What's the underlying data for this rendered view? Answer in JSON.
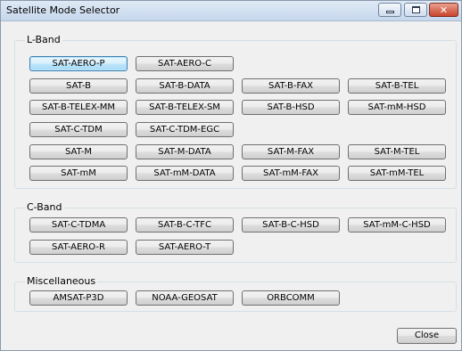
{
  "window": {
    "title": "Satellite Mode Selector"
  },
  "groups": {
    "lband": {
      "label": "L-Band",
      "buttons": [
        "SAT-AERO-P",
        "SAT-AERO-C",
        "SAT-B",
        "SAT-B-DATA",
        "SAT-B-FAX",
        "SAT-B-TEL",
        "SAT-B-TELEX-MM",
        "SAT-B-TELEX-SM",
        "SAT-B-HSD",
        "SAT-mM-HSD",
        "SAT-C-TDM",
        "SAT-C-TDM-EGC",
        "SAT-M",
        "SAT-M-DATA",
        "SAT-M-FAX",
        "SAT-M-TEL",
        "SAT-mM",
        "SAT-mM-DATA",
        "SAT-mM-FAX",
        "SAT-mM-TEL"
      ]
    },
    "cband": {
      "label": "C-Band",
      "buttons": [
        "SAT-C-TDMA",
        "SAT-B-C-TFC",
        "SAT-B-C-HSD",
        "SAT-mM-C-HSD",
        "SAT-AERO-R",
        "SAT-AERO-T"
      ]
    },
    "misc": {
      "label": "Miscellaneous",
      "buttons": [
        "AMSAT-P3D",
        "NOAA-GEOSAT",
        "ORBCOMM"
      ]
    }
  },
  "close_label": "Close",
  "selected": "SAT-AERO-P"
}
